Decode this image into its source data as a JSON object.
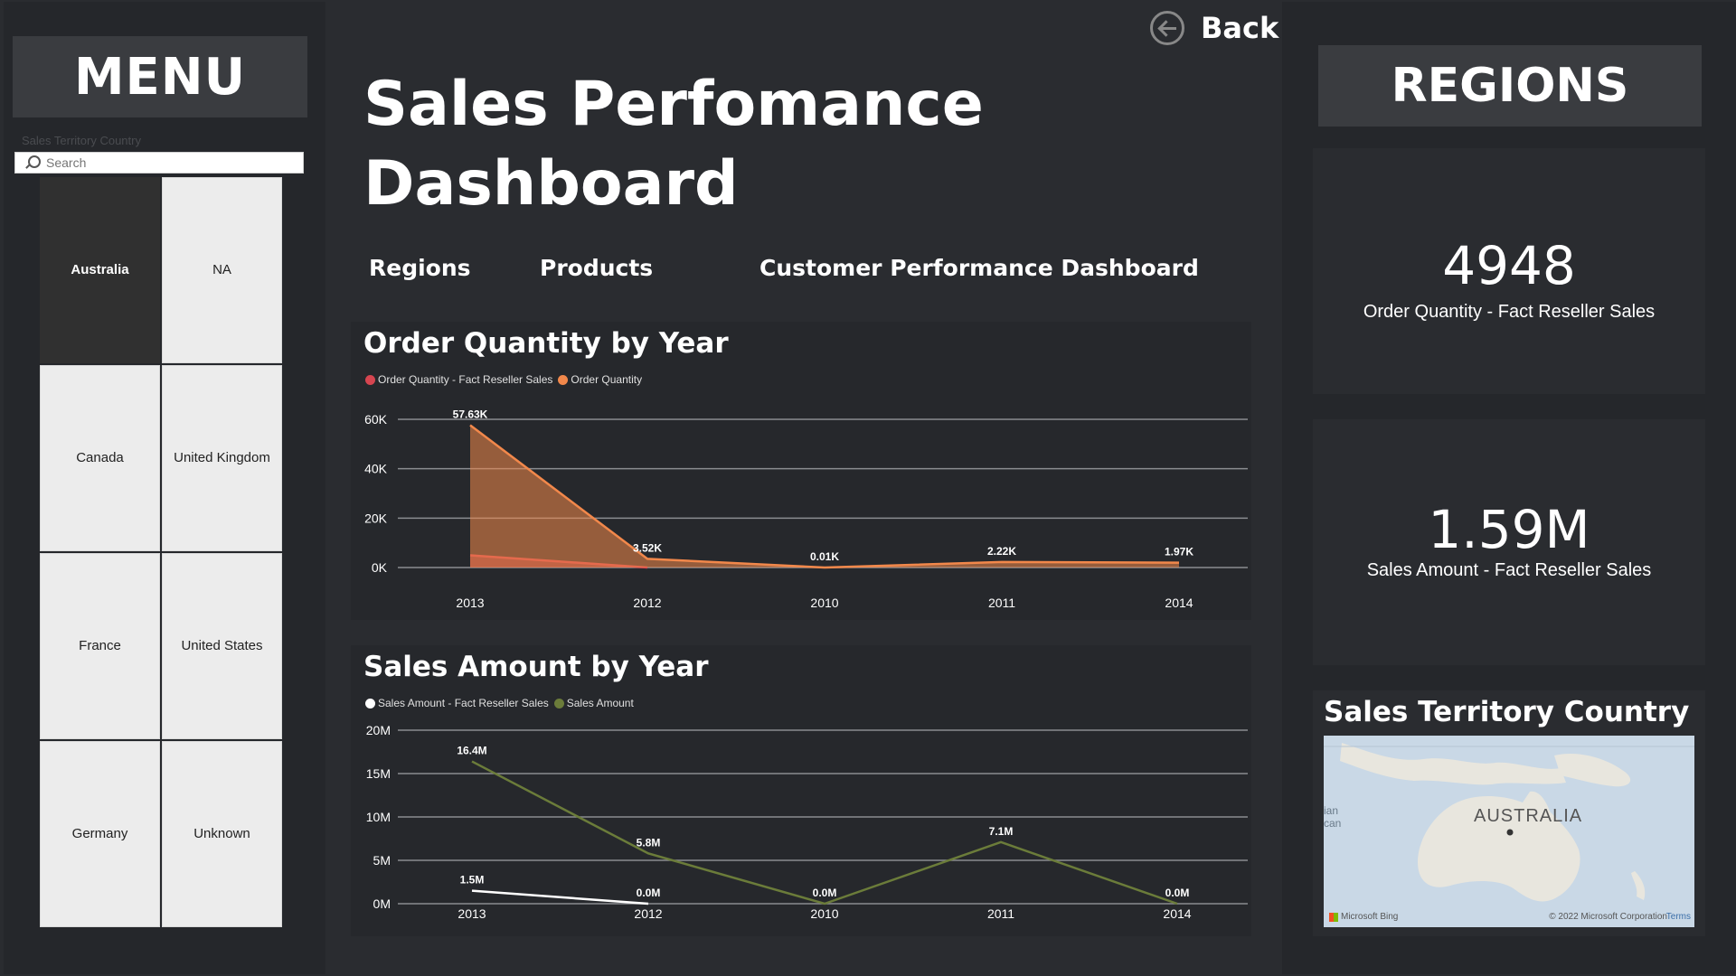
{
  "menu": {
    "title": "MENU",
    "slicer_title": "Sales Territory Country",
    "search_placeholder": "Search",
    "tiles": [
      {
        "label": "Australia",
        "selected": true
      },
      {
        "label": "NA",
        "selected": false
      },
      {
        "label": "Canada",
        "selected": false
      },
      {
        "label": "United Kingdom",
        "selected": false
      },
      {
        "label": "France",
        "selected": false
      },
      {
        "label": "United States",
        "selected": false
      },
      {
        "label": "Germany",
        "selected": false
      },
      {
        "label": "Unknown",
        "selected": false
      }
    ]
  },
  "header": {
    "back_label": "Back",
    "title": "Sales Perfomance Dashboard",
    "nav": {
      "regions": "Regions",
      "products": "Products",
      "customer": "Customer Performance Dashboard"
    }
  },
  "charts": {
    "quantity_title": "Order Quantity by Year",
    "amount_title": "Sales Amount by Year"
  },
  "chart_data": [
    {
      "type": "area",
      "title": "Order Quantity by Year",
      "categories": [
        "2013",
        "2012",
        "2010",
        "2011",
        "2014"
      ],
      "yticks": [
        "60K",
        "40K",
        "20K",
        "0K"
      ],
      "ylim": [
        0,
        60000
      ],
      "series": [
        {
          "name": "Order Quantity - Fact Reseller Sales",
          "color": "#d64550",
          "values": [
            4948,
            0,
            null,
            null,
            null
          ],
          "labels": [
            null,
            null,
            null,
            null,
            null
          ]
        },
        {
          "name": "Order Quantity",
          "color": "#f2884b",
          "values": [
            57630,
            3520,
            10,
            2220,
            1970
          ],
          "labels": [
            "57.63K",
            "3.52K",
            "0.01K",
            "2.22K",
            "1.97K"
          ]
        }
      ]
    },
    {
      "type": "line",
      "title": "Sales Amount by Year",
      "categories": [
        "2013",
        "2012",
        "2010",
        "2011",
        "2014"
      ],
      "yticks": [
        "20M",
        "15M",
        "10M",
        "5M",
        "0M"
      ],
      "ylim": [
        0,
        20000000
      ],
      "series": [
        {
          "name": "Sales Amount - Fact Reseller Sales",
          "color": "#ffffff",
          "values": [
            1500000,
            0,
            null,
            null,
            null
          ],
          "labels": [
            "1.5M",
            "0.0M",
            null,
            null,
            null
          ]
        },
        {
          "name": "Sales Amount",
          "color": "#6b7c3a",
          "values": [
            16400000,
            5800000,
            0,
            7100000,
            0
          ],
          "labels": [
            "16.4M",
            "5.8M",
            "0.0M",
            "7.1M",
            "0.0M"
          ]
        }
      ]
    }
  ],
  "regions": {
    "title": "REGIONS",
    "kpi_quantity_value": "4948",
    "kpi_quantity_label": "Order Quantity - Fact Reseller Sales",
    "kpi_amount_value": "1.59M",
    "kpi_amount_label": "Sales Amount - Fact Reseller Sales",
    "map_title": "Sales Territory Country",
    "map_country": "AUSTRALIA",
    "map_ocean": "ian\ncan",
    "map_provider": "Microsoft Bing",
    "map_copyright": "© 2022 Microsoft Corporation",
    "map_terms": "Terms"
  }
}
